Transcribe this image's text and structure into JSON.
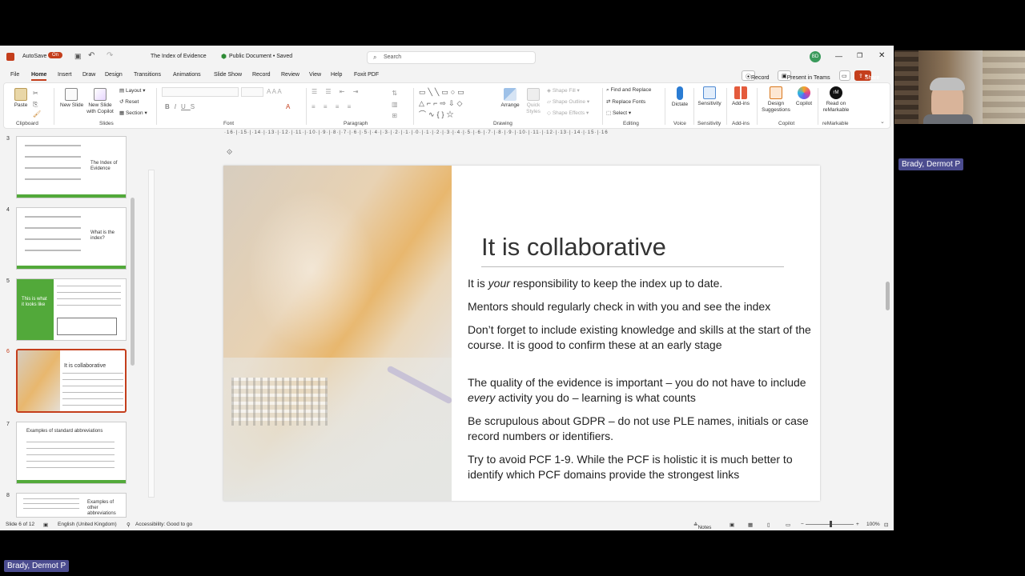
{
  "titlebar": {
    "autosave": "AutoSave",
    "toggle": "On",
    "doc_title": "The Index of Evidence",
    "doc_status": "Public Document • Saved",
    "search_placeholder": "Search",
    "user_initials": "BD"
  },
  "menu": {
    "tabs": [
      "File",
      "Home",
      "Insert",
      "Draw",
      "Design",
      "Transitions",
      "Animations",
      "Slide Show",
      "Record",
      "Review",
      "View",
      "Help",
      "Foxit PDF"
    ],
    "record": "Record",
    "present_teams": "Present in Teams",
    "share": "Share"
  },
  "ribbon": {
    "paste": "Paste",
    "new_slide": "New Slide",
    "new_slide_copilot": "New Slide with Copilot",
    "layout": "Layout",
    "reset": "Reset",
    "section": "Section",
    "arrange": "Arrange",
    "quick_styles": "Quick Styles",
    "shape_fill": "Shape Fill",
    "shape_outline": "Shape Outline",
    "shape_effects": "Shape Effects",
    "find_replace": "Find and Replace",
    "replace_fonts": "Replace Fonts",
    "select": "Select",
    "dictate": "Dictate",
    "sensitivity": "Sensitivity",
    "addins": "Add-ins",
    "design_suggestions": "Design Suggestions",
    "copilot": "Copilot",
    "read_remarkable": "Read on reMarkable",
    "groups": {
      "clipboard": "Clipboard",
      "slides": "Slides",
      "font": "Font",
      "paragraph": "Paragraph",
      "drawing": "Drawing",
      "editing": "Editing",
      "voice": "Voice",
      "sensitivity": "Sensitivity",
      "addins": "Add-ins",
      "copilot": "Copilot",
      "remarkable": "reMarkable"
    }
  },
  "thumbnails": [
    {
      "num": "3",
      "title": "The Index of Evidence"
    },
    {
      "num": "4",
      "title": "What is the index?"
    },
    {
      "num": "5",
      "title": "This is what it looks like"
    },
    {
      "num": "6",
      "title": "It is collaborative"
    },
    {
      "num": "7",
      "title": "Examples of standard abbreviations"
    },
    {
      "num": "8",
      "title": "Examples of other abbreviations"
    }
  ],
  "slide": {
    "title": "It is collaborative",
    "p1_a": "It is ",
    "p1_em": "your",
    "p1_b": " responsibility to keep the index up to date.",
    "p2": "Mentors should regularly check in with you and see the index",
    "p3": "Don’t forget to include existing knowledge and skills at the start of the course. It is good to confirm these at an early stage",
    "p4_a": "The quality of the evidence is important – you do not have to include ",
    "p4_em": "every",
    "p4_b": " activity you do – learning is what counts",
    "p5": "Be scrupulous about GDPR – do not use PLE names, initials or case record numbers or identifiers.",
    "p6": "Try to avoid PCF 1-9. While the PCF is holistic it is much better to identify which PCF domains provide the strongest links"
  },
  "status": {
    "slide_of": "Slide 6 of 12",
    "language": "English (United Kingdom)",
    "accessibility": "Accessibility: Good to go",
    "notes": "Notes",
    "zoom": "100%"
  },
  "participant": {
    "name": "Brady, Dermot P"
  },
  "colors": {
    "accent": "#c43e1c",
    "green": "#52a93a",
    "nameplate": "#4b4c8f"
  }
}
